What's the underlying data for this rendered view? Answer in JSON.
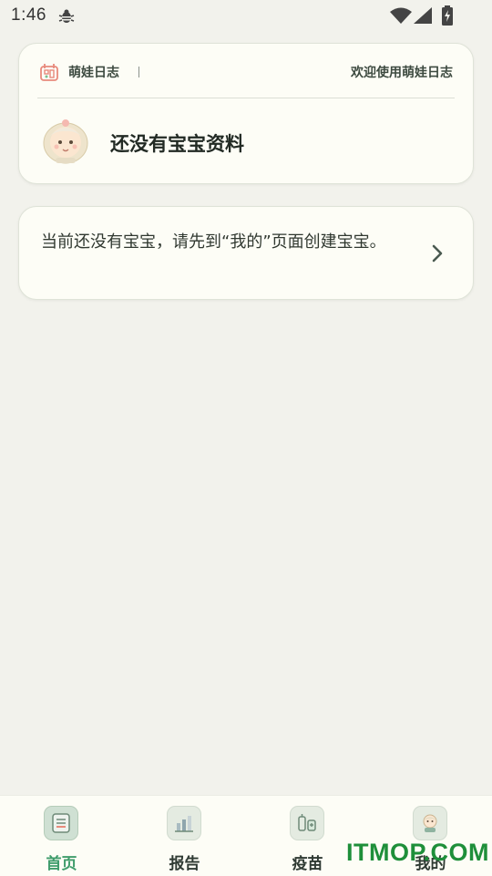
{
  "status_bar": {
    "time": "1:46"
  },
  "header": {
    "app_name": "萌娃日志",
    "welcome": "欢迎使用萌娃日志",
    "profile_status": "还没有宝宝资料"
  },
  "notice": {
    "text": "当前还没有宝宝，请先到“我的”页面创建宝宝。"
  },
  "bottom_nav": {
    "items": [
      {
        "label": "首页",
        "icon": "home-icon",
        "active": true
      },
      {
        "label": "报告",
        "icon": "report-icon",
        "active": false
      },
      {
        "label": "疫苗",
        "icon": "vaccine-icon",
        "active": false
      },
      {
        "label": "我的",
        "icon": "profile-icon",
        "active": false
      }
    ]
  },
  "colors": {
    "background": "#f2f2ec",
    "card": "#fdfdf6",
    "accent_green": "#3f9c6b"
  },
  "watermark": {
    "text": "ITMOP.COM"
  }
}
